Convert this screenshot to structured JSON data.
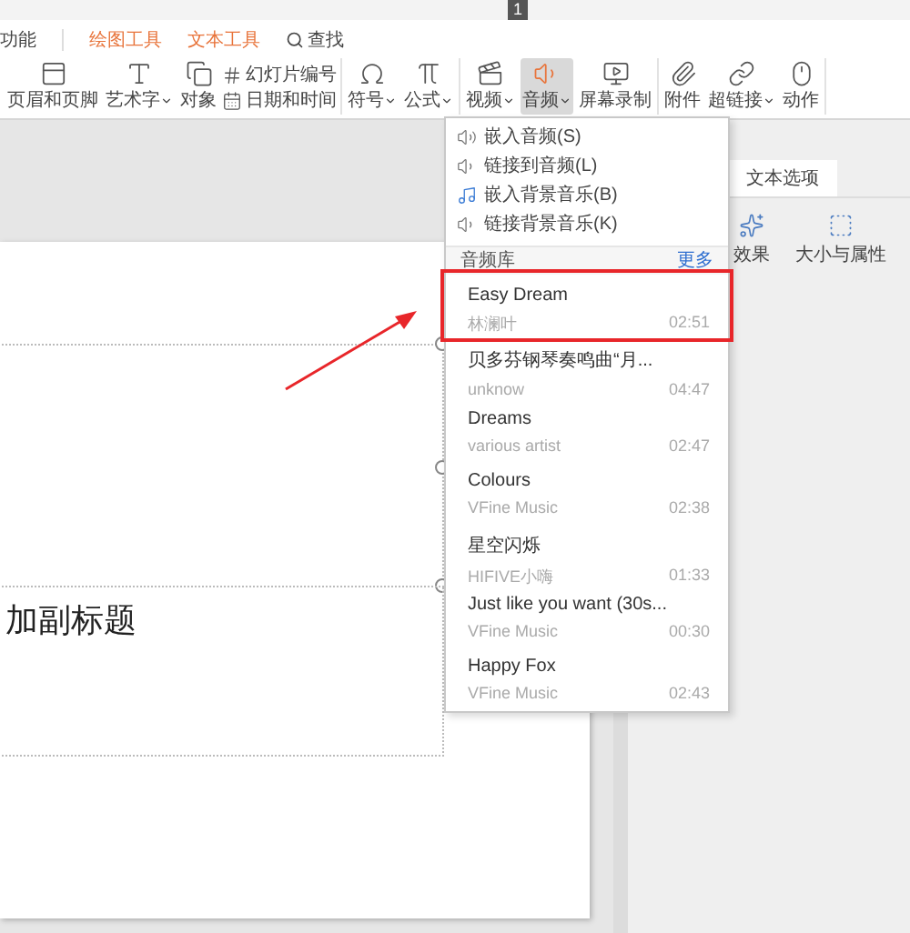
{
  "page_badge": "1",
  "tabs": [
    {
      "label": "功能",
      "kind": "plain"
    },
    {
      "label": "绘图工具",
      "kind": "context"
    },
    {
      "label": "文本工具",
      "kind": "context"
    },
    {
      "label": "查找",
      "kind": "search"
    }
  ],
  "ribbon": {
    "groups": [
      [
        {
          "kind": "large",
          "label": "页眉和页脚",
          "dropdown": false,
          "pressed": false
        },
        {
          "kind": "large",
          "label": "艺术字",
          "dropdown": true,
          "pressed": false
        },
        {
          "kind": "large",
          "label": "对象",
          "dropdown": false,
          "pressed": false
        },
        {
          "kind": "stack",
          "items": [
            {
              "label": "幻灯片编号"
            },
            {
              "label": "日期和时间"
            }
          ]
        }
      ],
      [
        {
          "kind": "large",
          "label": "符号",
          "dropdown": true,
          "pressed": false
        },
        {
          "kind": "large",
          "label": "公式",
          "dropdown": true,
          "pressed": false
        }
      ],
      [
        {
          "kind": "large",
          "label": "视频",
          "dropdown": true,
          "pressed": false
        },
        {
          "kind": "large",
          "label": "音频",
          "dropdown": true,
          "pressed": true
        },
        {
          "kind": "large",
          "label": "屏幕录制",
          "dropdown": false,
          "pressed": false
        }
      ],
      [
        {
          "kind": "large",
          "label": "附件",
          "dropdown": false,
          "pressed": false
        },
        {
          "kind": "large",
          "label": "超链接",
          "dropdown": true,
          "pressed": false
        },
        {
          "kind": "large",
          "label": "动作",
          "dropdown": false,
          "pressed": false
        }
      ]
    ]
  },
  "audio_menu": {
    "commands": [
      {
        "label": "嵌入音频(S)"
      },
      {
        "label": "链接到音频(L)"
      },
      {
        "label": "嵌入背景音乐(B)"
      },
      {
        "label": "链接背景音乐(K)"
      }
    ],
    "library": {
      "title": "音频库",
      "more": "更多",
      "songs": [
        {
          "title": "Easy Dream",
          "artist": "林澜叶",
          "duration": "02:51",
          "highlighted": true
        },
        {
          "title": "贝多芬钢琴奏鸣曲“月...",
          "artist": "unknow",
          "duration": "04:47",
          "highlighted": false
        },
        {
          "title": "Dreams",
          "artist": "various artist",
          "duration": "02:47",
          "highlighted": false
        },
        {
          "title": "Colours",
          "artist": "VFine Music",
          "duration": "02:38",
          "highlighted": false
        },
        {
          "title": "星空闪烁",
          "artist": "HIFIVE小嗨",
          "duration": "01:33",
          "highlighted": false
        },
        {
          "title": "Just like you want (30s...",
          "artist": "VFine Music",
          "duration": "00:30",
          "highlighted": false
        },
        {
          "title": "Happy Fox",
          "artist": "VFine Music",
          "duration": "02:43",
          "highlighted": false
        }
      ]
    }
  },
  "side_panel": {
    "tab": "文本选项",
    "tools": [
      {
        "label": "效果"
      },
      {
        "label": "大小与属性"
      }
    ]
  },
  "slide": {
    "subtitle": "加副标题"
  }
}
